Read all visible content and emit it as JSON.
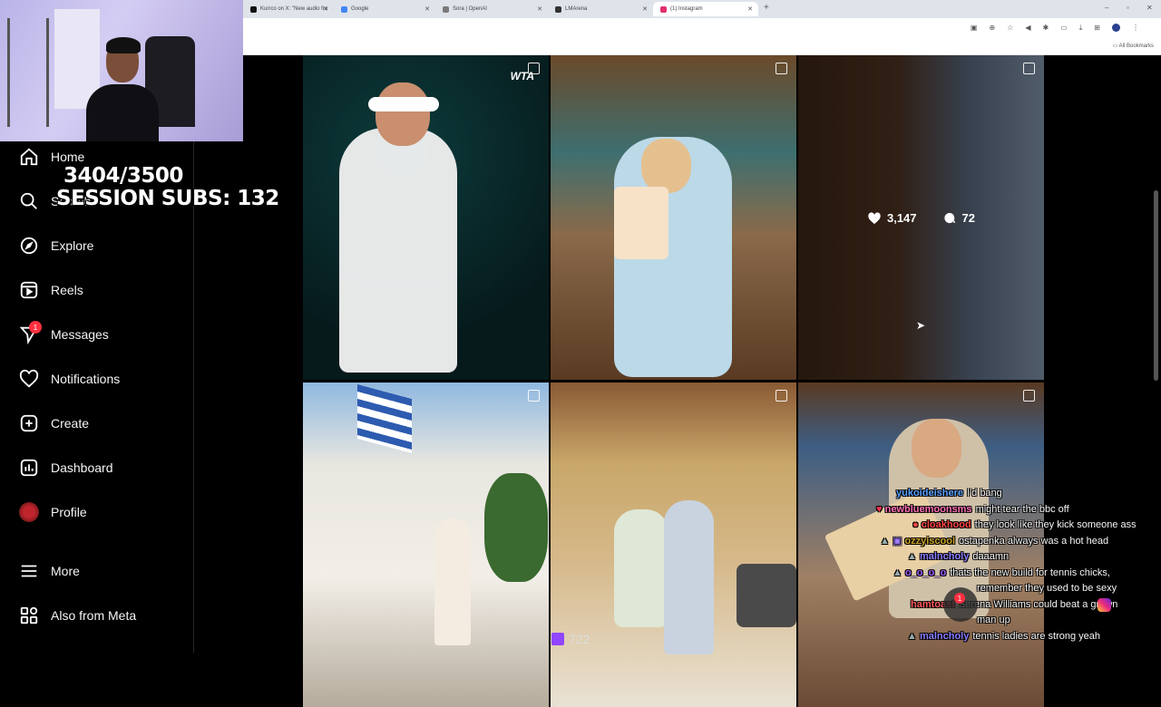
{
  "browser": {
    "tabs": [
      {
        "label": "Kurrco on X: \"New audio fro",
        "color": "#111111"
      },
      {
        "label": "Google",
        "color": "#4285f4"
      },
      {
        "label": "Sora | OpenAI",
        "color": "#7a7a7a"
      },
      {
        "label": "LMArena",
        "color": "#333333"
      },
      {
        "label": "(1) Instagram",
        "color": "#e1306c"
      }
    ],
    "bookmarks_label": "All Bookmarks"
  },
  "stream_overlay": {
    "sub_count": "3404/3500",
    "session_subs": "SESSION SUBS: 132",
    "viewers": "722"
  },
  "sidebar": {
    "items": [
      {
        "label": "Home",
        "icon": "home-icon"
      },
      {
        "label": "Search",
        "icon": "search-icon"
      },
      {
        "label": "Explore",
        "icon": "compass-icon"
      },
      {
        "label": "Reels",
        "icon": "reels-icon"
      },
      {
        "label": "Messages",
        "icon": "messenger-icon",
        "badge": "1"
      },
      {
        "label": "Notifications",
        "icon": "heart-icon"
      },
      {
        "label": "Create",
        "icon": "plus-square-icon"
      },
      {
        "label": "Dashboard",
        "icon": "dashboard-icon"
      },
      {
        "label": "Profile",
        "icon": "avatar"
      },
      {
        "label": "More",
        "icon": "menu-icon"
      },
      {
        "label": "Also from Meta",
        "icon": "meta-apps-icon"
      }
    ]
  },
  "grid": {
    "hover_post": {
      "likes": "3,147",
      "comments": "72"
    },
    "watermark": "WTA"
  },
  "chat": {
    "messages": [
      {
        "user": "yukoideishere",
        "color": "#5aa0ff",
        "text": "I'd bang"
      },
      {
        "user": "newbluemoonsms",
        "color": "#ff6fb5",
        "text": "might tear the bbc off"
      },
      {
        "user": "cloakhood",
        "color": "#ff4444",
        "text": "they look like they kick someone ass"
      },
      {
        "user": "ozzyiscool",
        "color": "#c9a227",
        "text": "ostapenka always was a hot head"
      },
      {
        "user": "malncholy",
        "color": "#8a7dff",
        "text": "daaamn"
      },
      {
        "user": "o_o_o_o",
        "color": "#a05cff",
        "text": "thats the new build for tennis chicks,"
      },
      {
        "user": "",
        "color": "#ffffff",
        "text": "remember they used to be sexy"
      },
      {
        "user": "hamtoast",
        "color": "#ff5a5a",
        "text": "Serena Williams could beat a grown"
      },
      {
        "user": "",
        "color": "#ffffff",
        "text": "man up"
      },
      {
        "user": "malncholy",
        "color": "#8a7dff",
        "text": "tennis ladies are strong yeah"
      }
    ]
  },
  "notification_badge": "1"
}
